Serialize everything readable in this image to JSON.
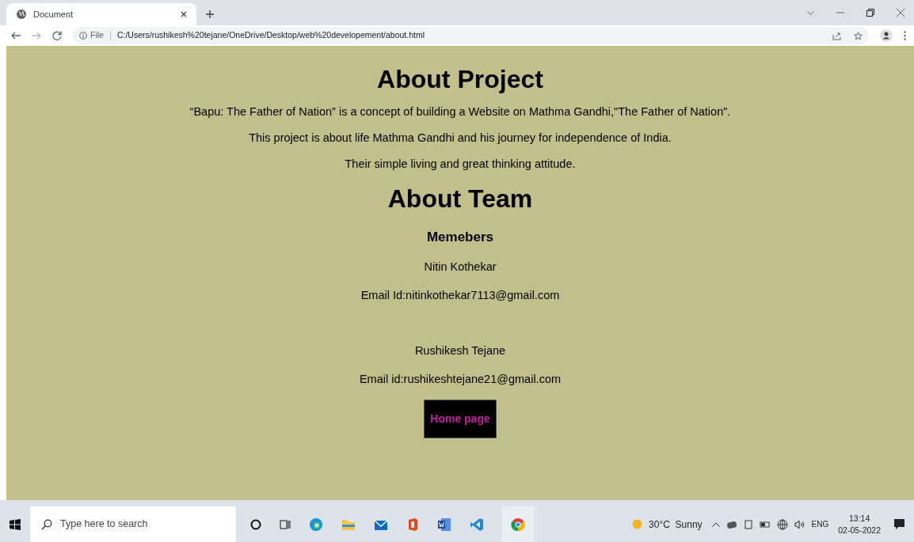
{
  "browser": {
    "tab": {
      "title": "Document",
      "selected": true
    },
    "address": {
      "scheme": "File",
      "url": "C:/Users/rushikesh%20tejane/OneDrive/Desktop/web%20developement/about.html"
    }
  },
  "page": {
    "project_heading": "About Project",
    "project_paragraphs": [
      "“Bapu: The Father of Nation” is a concept of building a Website on Mathma Gandhi,\"The Father of Nation\".",
      "This project is about life Mathma Gandhi and his journey for independence of India.",
      "Their simple living and great thinking attitude."
    ],
    "team_heading": "About Team",
    "members_heading": "Memebers",
    "members": [
      {
        "name": "Nitin Kothekar",
        "email": "Email Id:nitinkothekar7113@gmail.com"
      },
      {
        "name": "Rushikesh Tejane",
        "email": "Email id:rushikeshtejane21@gmail.com"
      }
    ],
    "home_button": "Home page"
  },
  "taskbar": {
    "search_placeholder": "Type here to search",
    "weather": "30°C  Sunny",
    "language": "ENG",
    "time": "13:14",
    "date": "02-05-2022"
  }
}
